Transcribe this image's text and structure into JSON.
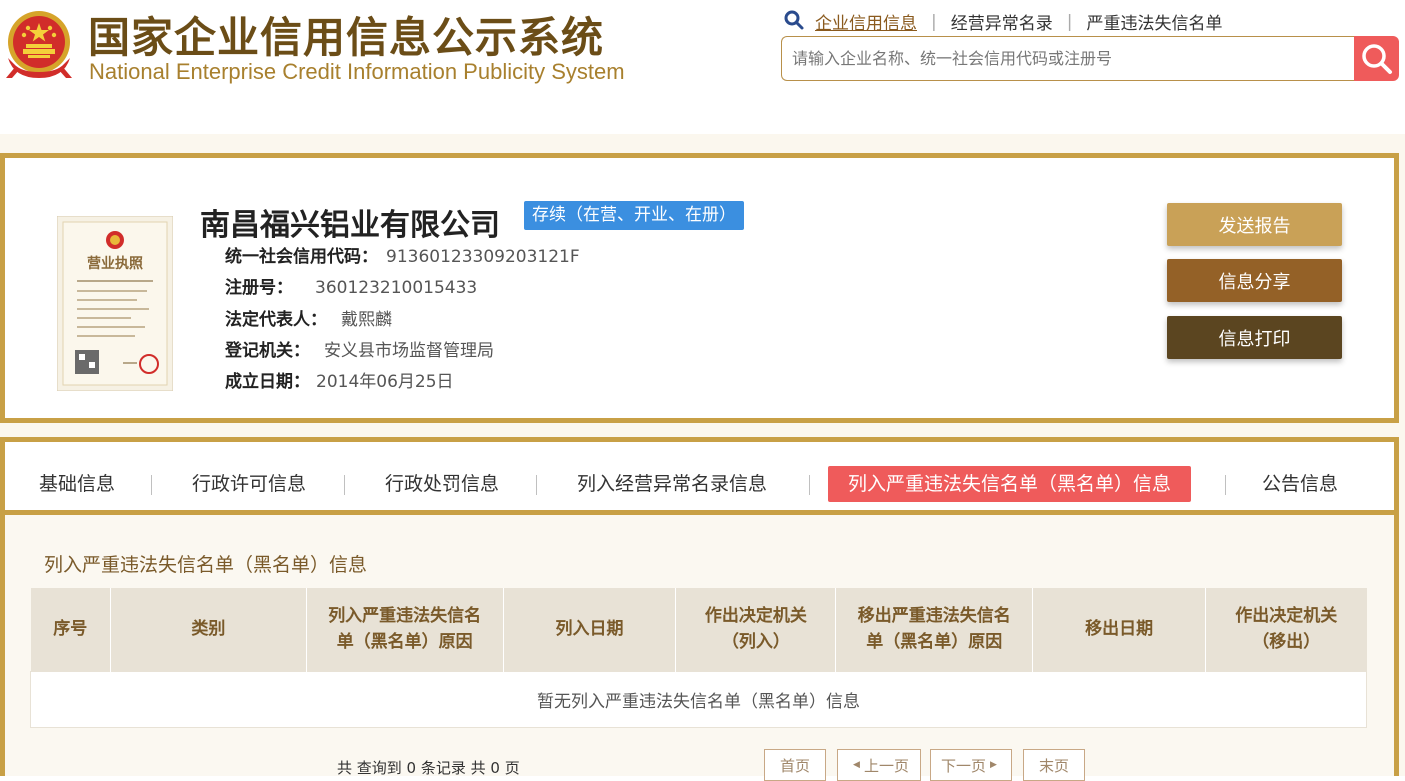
{
  "header": {
    "title_cn": "国家企业信用信息公示系统",
    "title_en": "National Enterprise Credit Information Publicity System",
    "nav": [
      "企业信用信息",
      "经营异常名录",
      "严重违法失信名单"
    ],
    "search_placeholder": "请输入企业名称、统一社会信用代码或注册号",
    "search_value": ""
  },
  "company": {
    "name": "南昌福兴铝业有限公司",
    "status": "存续（在营、开业、在册）",
    "fields": [
      {
        "label": "统一社会信用代码：",
        "value": "91360123309203121F"
      },
      {
        "label": "注册号：",
        "value": "360123210015433"
      },
      {
        "label": "法定代表人：",
        "value": "戴熙麟"
      },
      {
        "label": "登记机关：",
        "value": "安义县市场监督管理局"
      },
      {
        "label": "成立日期：",
        "value": "2014年06月25日"
      }
    ],
    "license_title": "营业执照"
  },
  "actions": {
    "send": "发送报告",
    "share": "信息分享",
    "print": "信息打印"
  },
  "tabs": [
    "基础信息",
    "行政许可信息",
    "行政处罚信息",
    "列入经营异常名录信息",
    "列入严重违法失信名单（黑名单）信息",
    "公告信息"
  ],
  "active_tab": "列入严重违法失信名单（黑名单）信息",
  "section": {
    "title": "列入严重违法失信名单（黑名单）信息",
    "columns": [
      [
        "序号"
      ],
      [
        "类别"
      ],
      [
        "列入严重违法失信名",
        "单（黑名单）原因"
      ],
      [
        "列入日期"
      ],
      [
        "作出决定机关",
        "（列入）"
      ],
      [
        "移出严重违法失信名",
        "单（黑名单）原因"
      ],
      [
        "移出日期"
      ],
      [
        "作出决定机关",
        "（移出）"
      ]
    ],
    "empty_text": "暂无列入严重违法失信名单（黑名单）信息"
  },
  "pagination": {
    "summary": "共 查询到 0 条记录 共 0 页",
    "first": "首页",
    "prev": "上一页",
    "next": "下一页",
    "last": "末页"
  },
  "icons": {
    "emblem": "national-emblem-icon",
    "search": "search-icon",
    "prev": "caret-left-icon",
    "next": "caret-right-icon"
  },
  "colors": {
    "gold_border": "#c8a046",
    "brand_brown": "#6b4d17",
    "accent_red": "#ef5b5b",
    "status_blue": "#3b8fe0",
    "btn_send": "#c9a157",
    "btn_share": "#946127",
    "btn_print": "#5b4520"
  }
}
